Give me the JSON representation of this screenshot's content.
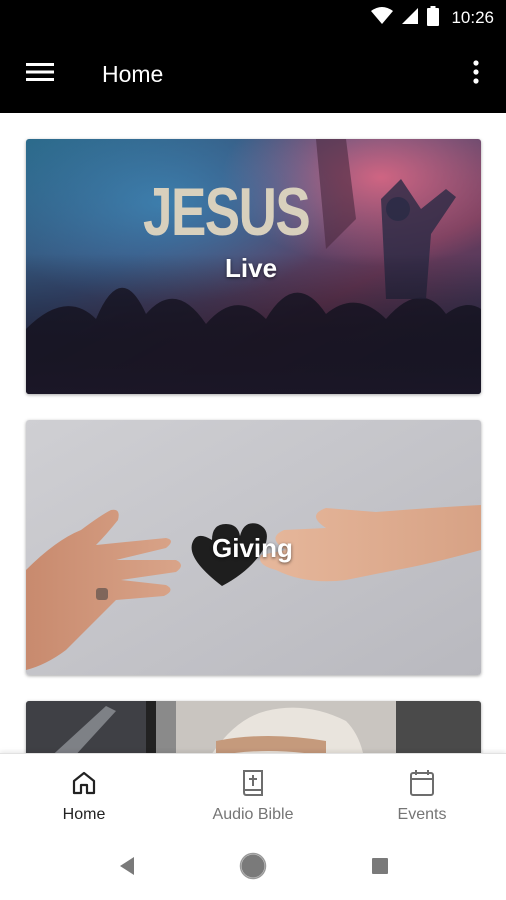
{
  "status_bar": {
    "time": "10:26",
    "icons": [
      "wifi-icon",
      "signal-icon",
      "battery-icon"
    ]
  },
  "app_bar": {
    "title": "Home",
    "menu_icon": "hamburger-menu-icon",
    "more_icon": "more-vert-icon"
  },
  "cards": [
    {
      "title": "Live",
      "image_text": "JESUS"
    },
    {
      "title": "Giving"
    },
    {
      "title": ""
    }
  ],
  "bottom_nav": {
    "items": [
      {
        "label": "Home",
        "icon": "home-icon",
        "active": true
      },
      {
        "label": "Audio Bible",
        "icon": "bible-icon",
        "active": false
      },
      {
        "label": "Events",
        "icon": "calendar-icon",
        "active": false
      }
    ]
  },
  "system_nav": {
    "buttons": [
      "back-icon",
      "home-circle-icon",
      "recents-icon"
    ]
  },
  "colors": {
    "app_bar": "#000000",
    "active_nav": "#222222",
    "inactive_nav": "#757575"
  }
}
